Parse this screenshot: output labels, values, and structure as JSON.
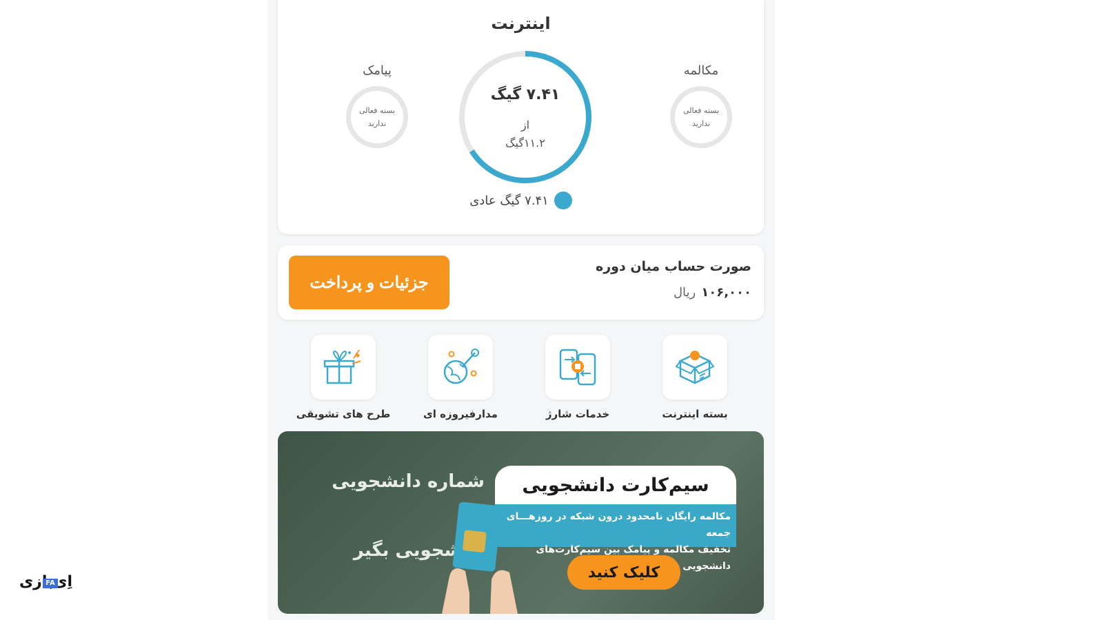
{
  "usage": {
    "title": "اینترنت",
    "calls": {
      "title": "مکالمه",
      "line1": "بسته فعالی",
      "line2": "ندارید"
    },
    "sms": {
      "title": "پیامک",
      "line1": "بسته فعالی",
      "line2": "ندارید"
    },
    "internet": {
      "used": "۷.۴۱ گیگ",
      "of": "از",
      "total": "۱۱.۲گیگ",
      "fraction_remaining": 0.66
    },
    "legend": {
      "label": "۷.۴۱ گیگ عادی",
      "color": "#3ba9cf"
    }
  },
  "bill": {
    "title": "صورت حساب میان دوره",
    "amount": "۱۰۶,۰۰۰",
    "unit": "ریال",
    "pay_button": "جزئیات و پرداخت"
  },
  "services": [
    {
      "label": "بسته اینترنت",
      "icon": "box-icon"
    },
    {
      "label": "خدمات شارژ",
      "icon": "phones-exchange-icon"
    },
    {
      "label": "مدارفیروزه ای",
      "icon": "globe-orbit-icon"
    },
    {
      "label": "طرح های تشویقی",
      "icon": "gift-icon"
    }
  ],
  "banner": {
    "headline": "سیم‌کارت دانشجویی",
    "line1": "مکالمه رایگان نامحدود درون شبکه در روزهـــای جمعه",
    "line2": "تخفیف مکالمه و پیامک بین سیم‌کارت‌های دانشجویی",
    "slogan1": "شماره دانشجویی بده",
    "slogan2": "دانشجویی بگیر",
    "cta": "کلیک کنید"
  },
  "watermark": {
    "text": "اِی‌بازی",
    "badge": "FA"
  },
  "colors": {
    "accent_orange": "#f7941d",
    "accent_blue": "#3ba9cf"
  }
}
